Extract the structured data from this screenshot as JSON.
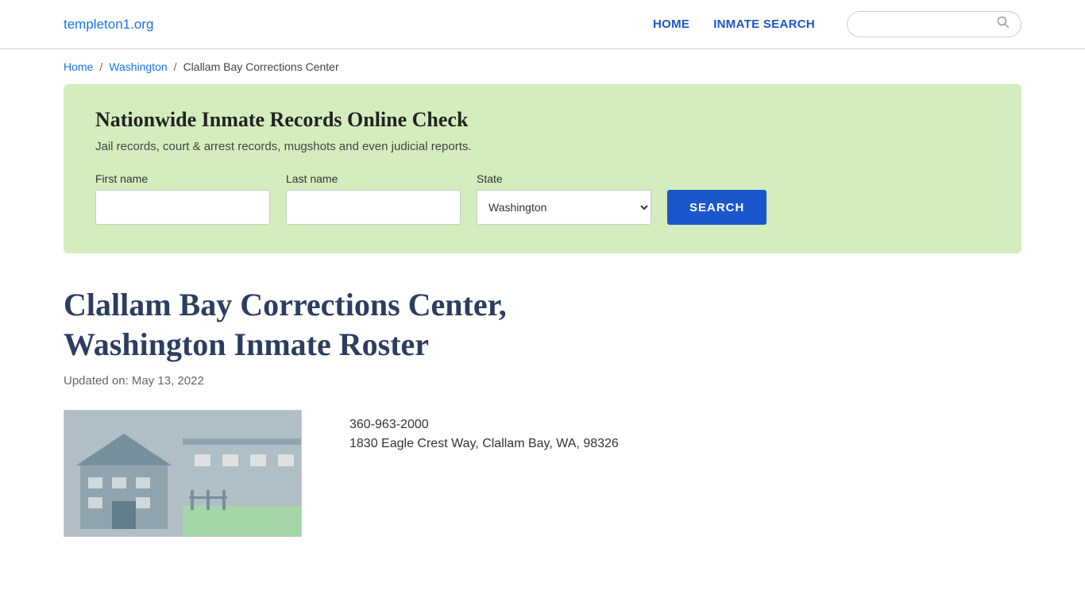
{
  "site": {
    "domain": "templeton1.org"
  },
  "header": {
    "nav": {
      "home_label": "HOME",
      "inmate_search_label": "INMATE SEARCH"
    },
    "search_placeholder": ""
  },
  "breadcrumb": {
    "home": "Home",
    "state": "Washington",
    "current": "Clallam Bay Corrections Center"
  },
  "search_panel": {
    "title": "Nationwide Inmate Records Online Check",
    "subtitle": "Jail records, court & arrest records, mugshots and even judicial reports.",
    "first_name_label": "First name",
    "last_name_label": "Last name",
    "state_label": "State",
    "state_value": "Washington",
    "search_button": "SEARCH"
  },
  "page": {
    "title": "Clallam Bay Corrections Center, Washington Inmate Roster",
    "updated": "Updated on: May 13, 2022",
    "phone": "360-963-2000",
    "address": "1830 Eagle Crest Way, Clallam Bay, WA, 98326"
  }
}
